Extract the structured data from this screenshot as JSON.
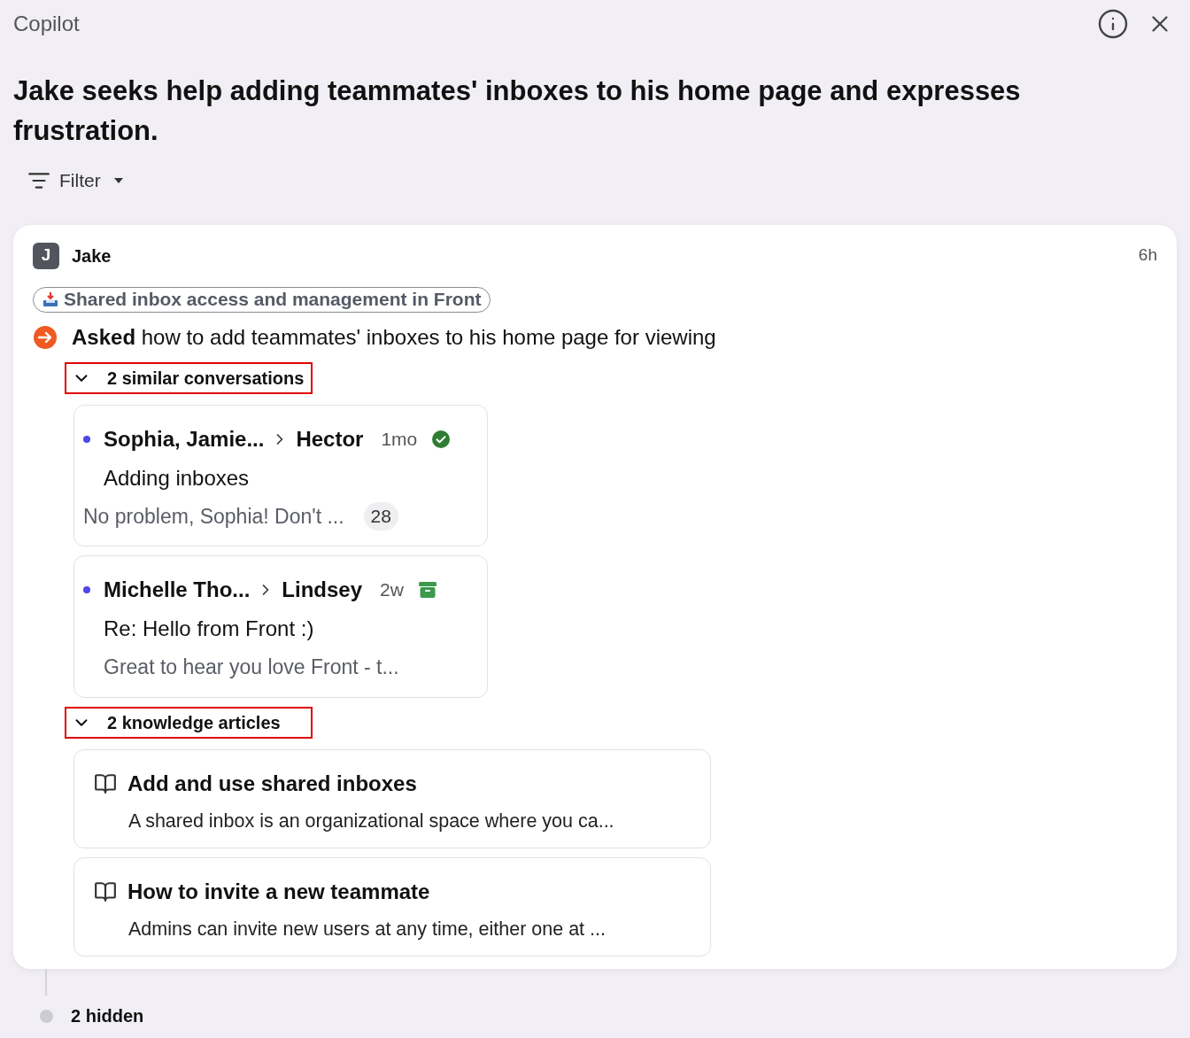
{
  "header": {
    "title": "Copilot"
  },
  "summary": "Jake seeks help adding teammates' inboxes to his home page and expresses frustration.",
  "filter": {
    "label": "Filter"
  },
  "card": {
    "avatar": "J",
    "name": "Jake",
    "time": "6h",
    "topic": "Shared inbox access and management in Front",
    "event": "**Asked** how to add teammates' inboxes to his home page for viewing",
    "sections": [
      {
        "kind": "conversations",
        "label": "2 similar conversations",
        "expanded": true,
        "highlighted": true,
        "items": [
          {
            "from": "Sophia, Jamie...",
            "to": "Hector",
            "time": "1mo",
            "kind": "done",
            "subject": "Adding inboxes",
            "preview": "No problem, Sophia! Don't ...",
            "count": "28",
            "unread": true
          },
          {
            "from": "Michelle Tho...",
            "to": "Lindsey",
            "time": "2w",
            "kind": "archived",
            "subject": "Re: Hello from Front :)",
            "preview": "Great to hear you love Front - t...",
            "unread": true
          }
        ]
      },
      {
        "kind": "articles",
        "label": "2 knowledge articles",
        "expanded": true,
        "highlighted": true,
        "items": [
          {
            "title": "Add and use shared inboxes",
            "preview": "A shared inbox is an organizational space where you ca..."
          },
          {
            "title": "How to invite a new teammate",
            "preview": "Admins can invite new users at any time, either one at ..."
          }
        ]
      }
    ]
  },
  "hidden": {
    "label": "2 hidden"
  }
}
